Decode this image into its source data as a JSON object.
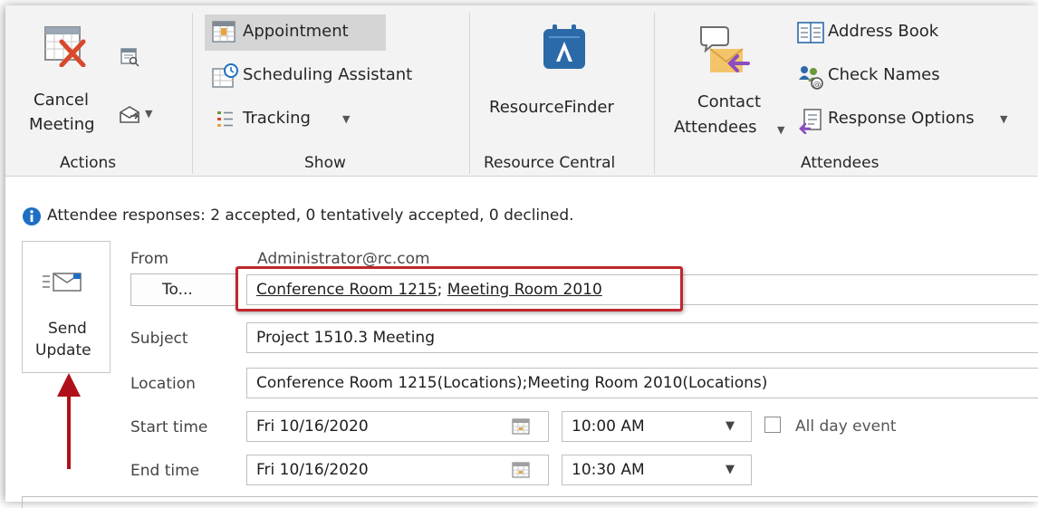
{
  "ribbon": {
    "actions": {
      "group_label": "Actions",
      "cancel_line1": "Cancel",
      "cancel_line2": "Meeting"
    },
    "show": {
      "group_label": "Show",
      "appointment": "Appointment",
      "scheduling": "Scheduling Assistant",
      "tracking": "Tracking"
    },
    "resource": {
      "group_label": "Resource Central",
      "finder": "ResourceFinder"
    },
    "attendees": {
      "group_label": "Attendees",
      "contact_line1": "Contact",
      "contact_line2": "Attendees",
      "address_book": "Address Book",
      "check_names": "Check Names",
      "response_options": "Response Options"
    }
  },
  "info": {
    "message": "Attendee responses: 2 accepted, 0 tentatively accepted, 0 declined."
  },
  "send": {
    "line1": "Send",
    "line2": "Update"
  },
  "form": {
    "from_label": "From",
    "from_value": "Administrator@rc.com",
    "to_button": "To...",
    "to_recipient_1": "Conference Room 1215",
    "to_separator": ";",
    "to_recipient_2": "Meeting Room 2010",
    "subject_label": "Subject",
    "subject_value": "Project 1510.3 Meeting",
    "location_label": "Location",
    "location_value": "Conference Room 1215(Locations);Meeting Room 2010(Locations)",
    "start_label": "Start time",
    "start_date": "Fri 10/16/2020",
    "start_time": "10:00 AM",
    "all_day_label": "All day event",
    "all_day_checked": false,
    "end_label": "End time",
    "end_date": "Fri 10/16/2020",
    "end_time": "10:30 AM"
  },
  "colors": {
    "highlight_box": "#c0272d",
    "arrow": "#b0101a",
    "info_icon": "#1e6fc3"
  }
}
